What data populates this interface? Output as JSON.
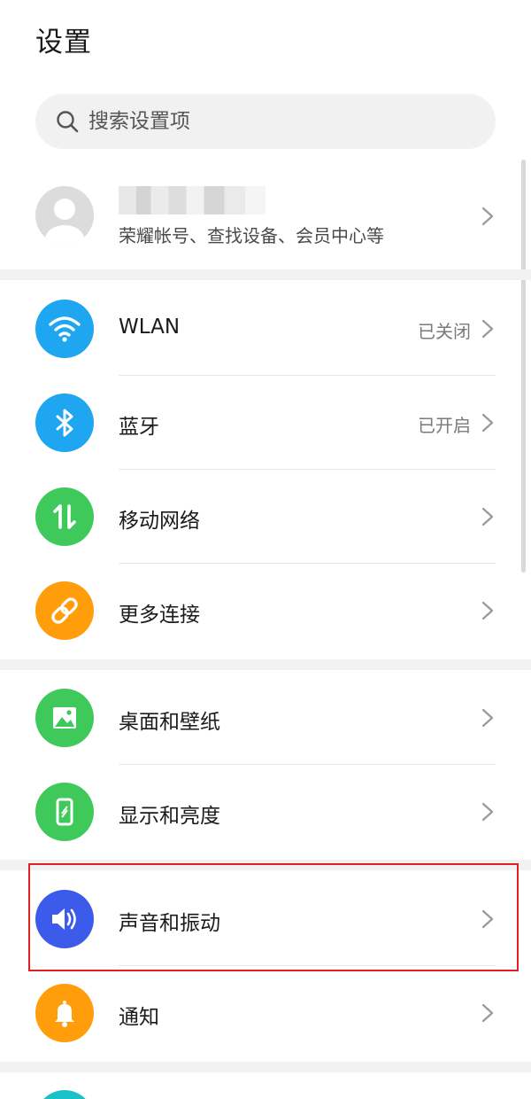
{
  "header": {
    "title": "设置"
  },
  "search": {
    "placeholder": "搜索设置项"
  },
  "account": {
    "subtitle": "荣耀帐号、查找设备、会员中心等"
  },
  "items": [
    {
      "id": "wlan",
      "label": "WLAN",
      "status": "已关闭",
      "color": "#1ea6f0",
      "icon": "wifi-icon"
    },
    {
      "id": "bluetooth",
      "label": "蓝牙",
      "status": "已开启",
      "color": "#1ea6f0",
      "icon": "bluetooth-icon"
    },
    {
      "id": "mobile-network",
      "label": "移动网络",
      "color": "#3fc95a",
      "icon": "mobile-data-icon"
    },
    {
      "id": "more-connections",
      "label": "更多连接",
      "color": "#ff9d0a",
      "icon": "link-icon"
    },
    {
      "id": "wallpaper",
      "label": "桌面和壁纸",
      "color": "#3fc95a",
      "icon": "image-icon"
    },
    {
      "id": "display",
      "label": "显示和亮度",
      "color": "#3fc95a",
      "icon": "phone-brightness-icon"
    },
    {
      "id": "sound",
      "label": "声音和振动",
      "color": "#3d5bea",
      "icon": "speaker-icon"
    },
    {
      "id": "notifications",
      "label": "通知",
      "color": "#ff9d0a",
      "icon": "bell-icon"
    }
  ],
  "highlight_color": "#e02020"
}
